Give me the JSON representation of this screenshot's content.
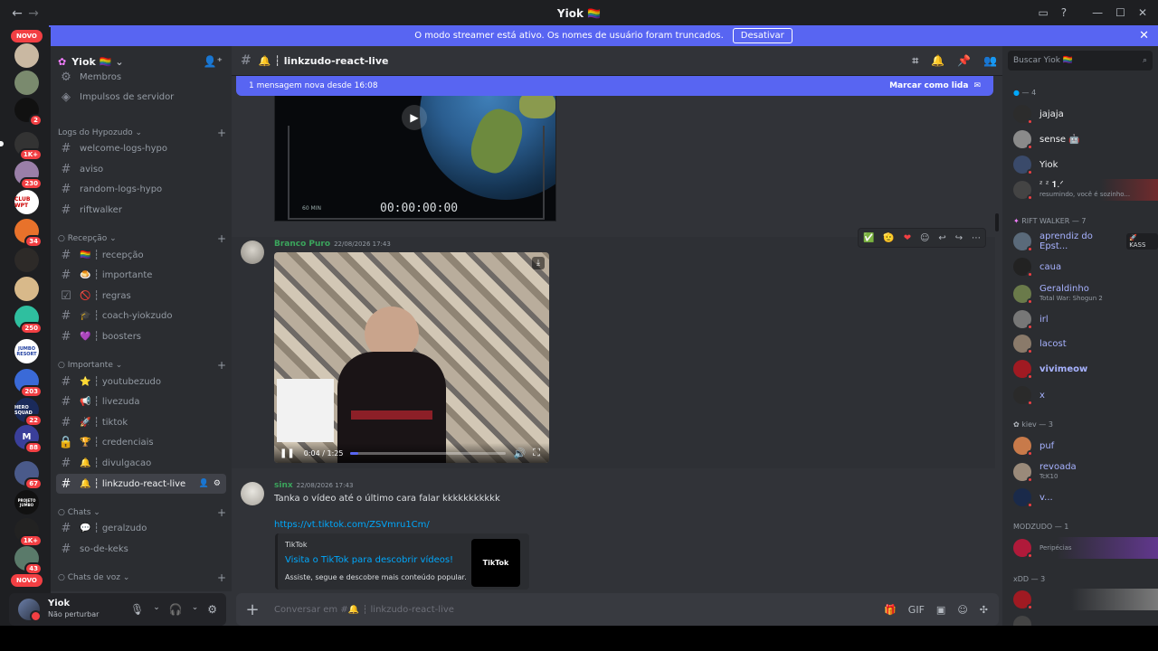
{
  "window": {
    "title": "Yiok 🏳️‍🌈"
  },
  "banner": {
    "text": "O modo streamer está ativo. Os nomes de usuário foram truncados.",
    "button": "Desativar"
  },
  "servers": {
    "novo": "NOVO",
    "badges": [
      "2",
      "1K+",
      "230",
      "34",
      "250",
      "203",
      "22",
      "88",
      "67",
      "1K+",
      "43"
    ],
    "novo_bottom": "NOVO",
    "labels": [
      "CLUB WPT",
      "JUMBO RESORT",
      "HERO SQUAD",
      "M",
      "PROJETO JUMBO"
    ]
  },
  "server": {
    "name": "Yiok 🏳️‍🌈"
  },
  "channels": {
    "top": [
      {
        "label": "Membros"
      },
      {
        "label": "Impulsos de servidor"
      }
    ],
    "cat1": {
      "label": "Logs do Hypozudo ⌄",
      "items": [
        "welcome-logs-hypo",
        "aviso",
        "random-logs-hypo",
        "riftwalker"
      ]
    },
    "cat2": {
      "label": "○ Recepção ⌄",
      "items": [
        "🏳️‍🌈 ┆ recepção",
        "🍮 ┆ importante",
        "🚫 ┆ regras",
        "🎓 ┆ coach-yiokzudo",
        "💜 ┆ boosters"
      ]
    },
    "cat3": {
      "label": "○ Importante ⌄",
      "items": [
        "⭐ ┆ youtubezudo",
        "📢 ┆ livezuda",
        "🚀 ┆ tiktok",
        "🏆 ┆ credenciais",
        "🔔 ┆ divulgacao",
        "🔔 ┆ linkzudo-react-live"
      ]
    },
    "cat4": {
      "label": "○ Chats ⌄",
      "items": [
        "💬 ┆ geralzudo",
        "so-de-keks"
      ]
    },
    "cat5": {
      "label": "○ Chats de voz ⌄"
    }
  },
  "user": {
    "name": "Yiok",
    "status": "Não perturbar"
  },
  "chat": {
    "channel": "🔔 ┆ linkzudo-react-live",
    "new_messages": "1 mensagem nova desde 16:08",
    "mark_read": "Marcar como lida",
    "video1": {
      "timecode": "00:00:00:00",
      "sublabel": "60 MIN"
    },
    "msg1": {
      "author": "Branco Puro",
      "time": "22/08/2026 17:43",
      "video_time": "0:04 / 1:25",
      "progress": 0.05
    },
    "msg2": {
      "author": "sinx",
      "time": "22/08/2026 17:43",
      "text": "Tanka o vídeo até o último cara falar kkkkkkkkkkk",
      "link": "https://vt.tiktok.com/ZSVmru1Cm/",
      "embed": {
        "provider": "TikTok",
        "title": "Visita o TikTok para descobrir vídeos!",
        "description": "Assiste, segue e descobre mais conteúdo popular.",
        "logo": "TikTok"
      }
    },
    "input_placeholder": "Conversar em #🔔 ┆ linkzudo-react-live"
  },
  "members": {
    "search": "Buscar Yiok 🏳️‍🌈",
    "groups": [
      {
        "label": "— 4",
        "members": [
          {
            "name": "jajaja",
            "color": "#f2f3f5"
          },
          {
            "name": "sense 🤖",
            "color": "#f2f3f5"
          },
          {
            "name": "Yiok",
            "color": "#f2f3f5"
          },
          {
            "name": "ᶻ ᶻ 𝟏.ᐟ",
            "color": "#f2f3f5",
            "activity": "resumindo, você é sozinho..."
          }
        ]
      },
      {
        "label": "RIFT WALKER — 7",
        "members": [
          {
            "name": "aprendiz do Epst...",
            "color": "#a7b2ff",
            "tag": "🚀 KASS"
          },
          {
            "name": "caua",
            "color": "#a7b2ff"
          },
          {
            "name": "Geraldinho",
            "color": "#a7b2ff",
            "activity": "Total War: Shogun 2"
          },
          {
            "name": "irl",
            "color": "#a7b2ff"
          },
          {
            "name": "lacost",
            "color": "#a7b2ff"
          },
          {
            "name": "vivimeow",
            "color": "#a7b2ff"
          },
          {
            "name": "x",
            "color": "#a7b2ff"
          }
        ]
      },
      {
        "label": "kiev — 3",
        "members": [
          {
            "name": "puf",
            "color": "#a7b2ff"
          },
          {
            "name": "revoada",
            "color": "#a7b2ff",
            "activity": "TcK10"
          },
          {
            "name": "v...",
            "color": "#a7b2ff"
          }
        ]
      },
      {
        "label": "MODZUDO — 1",
        "members": [
          {
            "name": "",
            "color": "#a7b2ff",
            "activity": "Peripécias"
          }
        ]
      },
      {
        "label": "xDD — 3",
        "members": []
      }
    ]
  }
}
